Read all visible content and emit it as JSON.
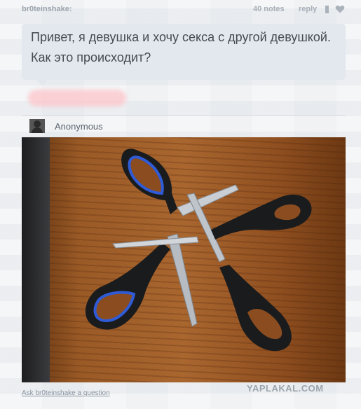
{
  "post": {
    "username": "br0teinshake:",
    "notes_label": "40 notes",
    "reply_label": "reply",
    "question_text": "Привет, я девушка и хочу секса с другой девушкой. Как это происходит?",
    "asker_name": "Anonymous",
    "ask_link": "Ask br0teinshake a question",
    "watermark": "YAPLAKAL.COM"
  },
  "icons": {
    "reblog": "reblog-icon",
    "like": "heart-icon",
    "avatar": "anonymous-avatar-icon"
  },
  "colors": {
    "bubble": "#e3e8ee",
    "meta_text": "#a7afb8",
    "scissor_handle_blue": "#2f5bd6",
    "scissor_handle_black": "#1a1b1d",
    "table_wood": "#9a5a26"
  }
}
